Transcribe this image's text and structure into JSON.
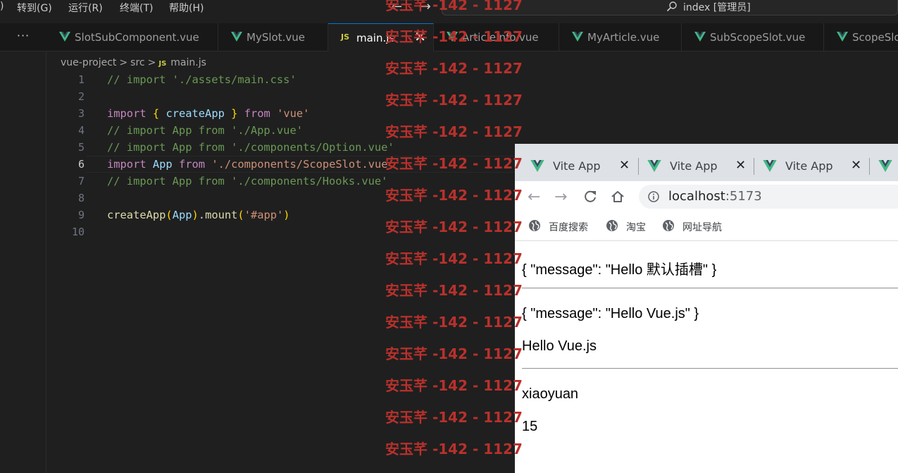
{
  "menu": {
    "items": [
      ")",
      "转到(G)",
      "运行(R)",
      "终端(T)",
      "帮助(H)"
    ],
    "nav_arrows": "← →",
    "search_text": "index [管理员]"
  },
  "editor_tabs": {
    "more": "···",
    "tabs": [
      {
        "label": "SlotSubComponent.vue",
        "icon": "vue-icon"
      },
      {
        "label": "MySlot.vue",
        "icon": "vue-icon"
      },
      {
        "label": "main.js",
        "icon": "js-icon",
        "active": true,
        "close": "✕"
      },
      {
        "label": "ArticleInfo.vue",
        "icon": "vue-icon"
      },
      {
        "label": "MyArticle.vue",
        "icon": "vue-icon"
      },
      {
        "label": "SubScopeSlot.vue",
        "icon": "vue-icon"
      },
      {
        "label": "ScopeSlo",
        "icon": "vue-icon"
      }
    ],
    "js_badge": "JS"
  },
  "breadcrumb": {
    "parts": [
      "vue-project",
      "src",
      "main.js"
    ],
    "sep": ">",
    "js_badge": "JS"
  },
  "editor": {
    "line_numbers": [
      "1",
      "2",
      "3",
      "4",
      "5",
      "6",
      "7",
      "8",
      "9",
      "10"
    ],
    "current_line": "6",
    "lines": [
      "// import './assets/main.css'",
      "",
      "import { createApp } from 'vue'",
      "// import App from './App.vue'",
      "// import App from './components/Option.vue'",
      "import App from './components/ScopeSlot.vue'",
      "// import App from './components/Hooks.vue'",
      "",
      "createApp(App).mount('#app')",
      ""
    ],
    "tokens": {
      "import": "import",
      "from": "from",
      "createApp": "createApp",
      "App": "App",
      "vue_str": "'vue'",
      "scope_str": "'./components/ScopeSlot.vue'",
      "mount": "mount",
      "app_str": "'#app'",
      "lbrace": "{",
      "rbrace": "}",
      "lparen": "(",
      "rparen": ")",
      "dot": ".",
      "space": " "
    }
  },
  "watermark": {
    "text": "安玉芊 -142 - 1127",
    "color": "#b8312c"
  },
  "browser": {
    "tabs": [
      {
        "title": "Vite App",
        "close": "✕"
      },
      {
        "title": "Vite App",
        "close": "✕"
      },
      {
        "title": "Vite App",
        "close": "✕"
      }
    ],
    "nav": {
      "back": "←",
      "forward": "→"
    },
    "url": {
      "host": "localhost",
      "port": ":5173"
    },
    "bookmarks": [
      "百度搜索",
      "淘宝",
      "网址导航"
    ],
    "page": {
      "line1": "{ \"message\": \"Hello 默认插槽\" }",
      "line2": "{ \"message\": \"Hello Vue.js\" }",
      "line3": "Hello Vue.js",
      "line4": "xiaoyuan",
      "line5": "15"
    }
  }
}
